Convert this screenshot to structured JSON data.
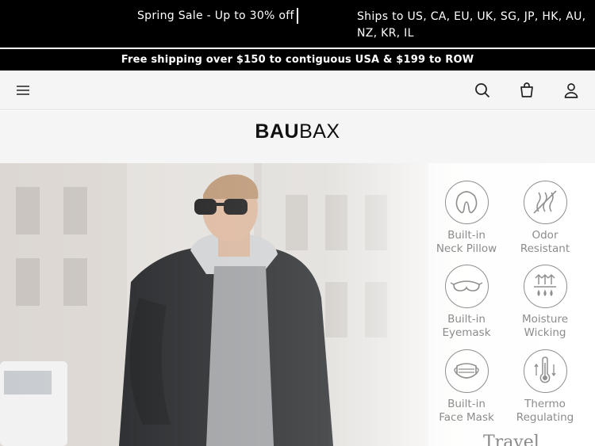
{
  "announcement": {
    "sale_text": "Spring Sale - Up to 30% off",
    "ships_text": "Ships to US, CA, EU, UK, SG, JP, HK, AU, NZ, KR, IL"
  },
  "shipping_notice": "Free shipping over $150 to contiguous USA & $199 to ROW",
  "header": {
    "logo_bold": "BAU",
    "logo_light": "BAX",
    "icons": [
      "menu-icon",
      "search-icon",
      "bag-icon",
      "account-icon"
    ]
  },
  "hero": {
    "features": [
      {
        "icon": "neck-pillow-icon",
        "line1": "Built-in",
        "line2": "Neck Pillow"
      },
      {
        "icon": "odor-resistant-icon",
        "line1": "Odor",
        "line2": "Resistant"
      },
      {
        "icon": "eyemask-icon",
        "line1": "Built-in",
        "line2": "Eyemask"
      },
      {
        "icon": "moisture-wicking-icon",
        "line1": "Moisture",
        "line2": "Wicking"
      },
      {
        "icon": "face-mask-icon",
        "line1": "Built-in",
        "line2": "Face Mask"
      },
      {
        "icon": "thermo-regulating-icon",
        "line1": "Thermo",
        "line2": "Regulating"
      }
    ],
    "script_text": "Travel"
  },
  "colors": {
    "bar_bg": "#000000",
    "header_bg": "#f5f5f5",
    "feature_gray": "#8c8c8c"
  }
}
